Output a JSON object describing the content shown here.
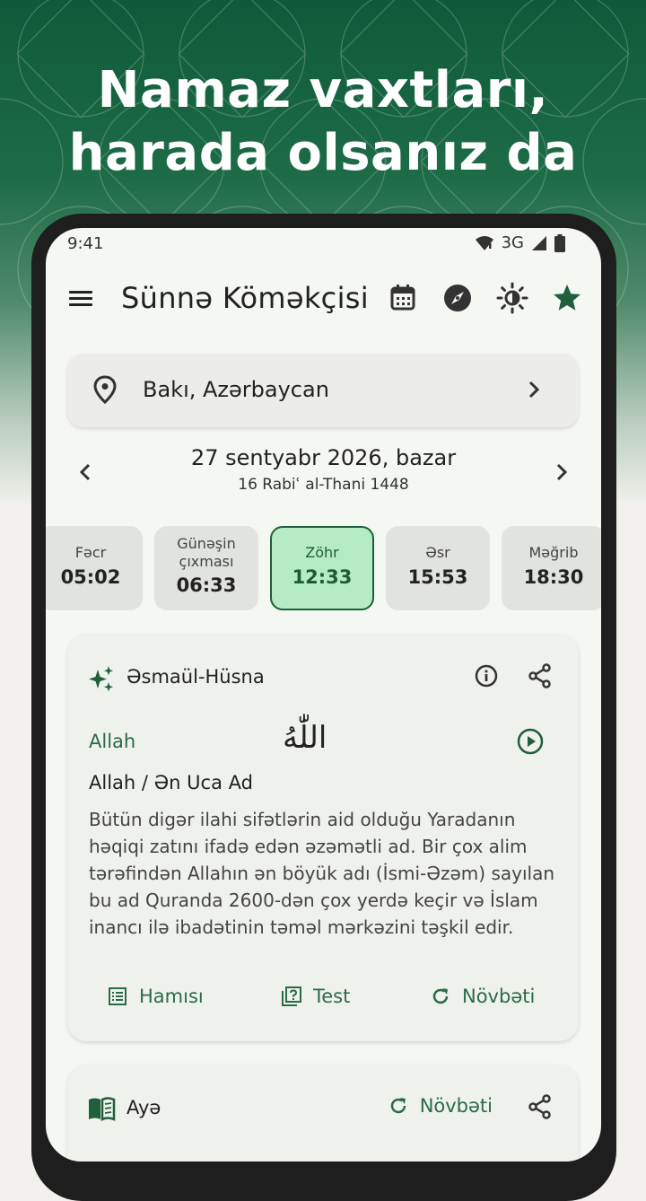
{
  "headline": {
    "line1": "Namaz vaxtları,",
    "line2": "harada olsanız da"
  },
  "status": {
    "time": "9:41",
    "network": "3G"
  },
  "appbar": {
    "title": "Sünnə Köməkçisi"
  },
  "location": {
    "text": "Bakı, Azərbaycan"
  },
  "date": {
    "main": "27 sentyabr 2026, bazar",
    "hijri": "16 Rabiʿ al-Thani 1448"
  },
  "prayers": [
    {
      "name": "Fəcr",
      "time": "05:02"
    },
    {
      "name": "Günəşin çıxması",
      "name1": "Günəşin",
      "name2": "çıxması",
      "time": "06:33"
    },
    {
      "name": "Zöhr",
      "time": "12:33",
      "active": true
    },
    {
      "name": "Əsr",
      "time": "15:53"
    },
    {
      "name": "Məğrib",
      "time": "18:30"
    }
  ],
  "names_card": {
    "title": "Əsmaül-Hüsna",
    "latin": "Allah",
    "arabic": "اللّٰهُ",
    "meaning": "Allah / Ən Uca Ad",
    "description": "Bütün digər ilahi sifətlərin aid olduğu Yaradanın həqiqi zatını ifadə edən əzəmətli ad. Bir çox alim tərəfindən Allahın ən böyük adı (İsmi-Əzəm) sayılan bu ad Quranda 2600-dən çox yerdə keçir və İslam inancı ilə ibadətinin təməl mərkəzini təşkil edir.",
    "actions": {
      "all": "Hamısı",
      "test": "Test",
      "next": "Növbəti"
    }
  },
  "verse_card": {
    "title": "Ayə",
    "next": "Növbəti"
  },
  "colors": {
    "primary": "#1f5f3b",
    "accent_light": "#b5ecc6",
    "hero": "#155e3d"
  }
}
